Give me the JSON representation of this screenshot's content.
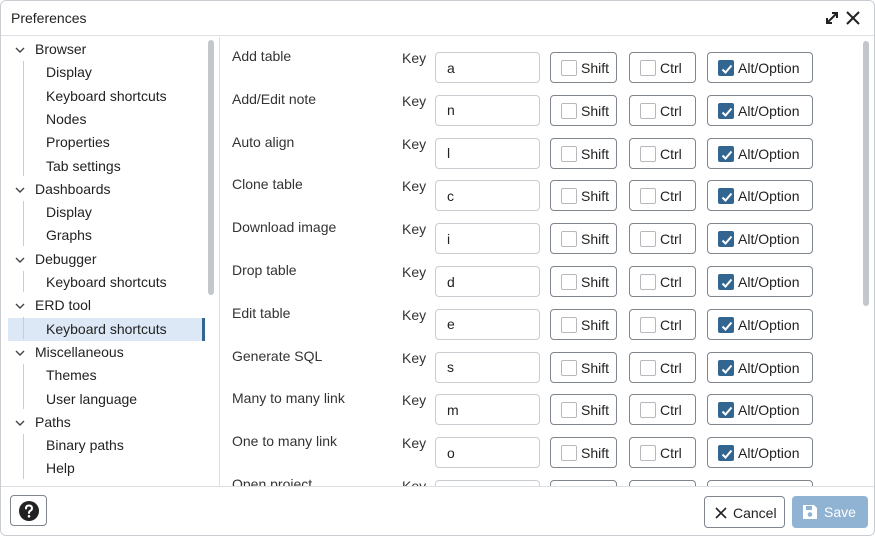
{
  "window": {
    "title": "Preferences"
  },
  "sidebar": {
    "groups": [
      {
        "label": "Browser",
        "children": [
          "Display",
          "Keyboard shortcuts",
          "Nodes",
          "Properties",
          "Tab settings"
        ]
      },
      {
        "label": "Dashboards",
        "children": [
          "Display",
          "Graphs"
        ]
      },
      {
        "label": "Debugger",
        "children": [
          "Keyboard shortcuts"
        ]
      },
      {
        "label": "ERD tool",
        "children": [
          "Keyboard shortcuts"
        ]
      },
      {
        "label": "Miscellaneous",
        "children": [
          "Themes",
          "User language"
        ]
      },
      {
        "label": "Paths",
        "children": [
          "Binary paths",
          "Help"
        ]
      }
    ],
    "selected": "ERD tool / Keyboard shortcuts"
  },
  "shortcuts": {
    "key_label": "Key",
    "shift_label": "Shift",
    "ctrl_label": "Ctrl",
    "alt_label": "Alt/Option",
    "rows": [
      {
        "label": "Add table",
        "key": "a",
        "shift": false,
        "ctrl": false,
        "alt": true
      },
      {
        "label": "Add/Edit note",
        "key": "n",
        "shift": false,
        "ctrl": false,
        "alt": true
      },
      {
        "label": "Auto align",
        "key": "l",
        "shift": false,
        "ctrl": false,
        "alt": true
      },
      {
        "label": "Clone table",
        "key": "c",
        "shift": false,
        "ctrl": false,
        "alt": true
      },
      {
        "label": "Download image",
        "key": "i",
        "shift": false,
        "ctrl": false,
        "alt": true
      },
      {
        "label": "Drop table",
        "key": "d",
        "shift": false,
        "ctrl": false,
        "alt": true
      },
      {
        "label": "Edit table",
        "key": "e",
        "shift": false,
        "ctrl": false,
        "alt": true
      },
      {
        "label": "Generate SQL",
        "key": "s",
        "shift": false,
        "ctrl": false,
        "alt": true
      },
      {
        "label": "Many to many link",
        "key": "m",
        "shift": false,
        "ctrl": false,
        "alt": true
      },
      {
        "label": "One to many link",
        "key": "o",
        "shift": false,
        "ctrl": false,
        "alt": true
      },
      {
        "label": "Open project",
        "key": "",
        "shift": false,
        "ctrl": false,
        "alt": true
      }
    ]
  },
  "footer": {
    "cancel_label": "Cancel",
    "save_label": "Save"
  },
  "colors": {
    "accent": "#326690",
    "selected_bg": "#dde8f7",
    "save_disabled": "#90b3d3"
  },
  "icons": {
    "expand": "expand-diagonal-icon",
    "close": "close-icon",
    "help": "help-circle-icon",
    "cancel": "close-icon",
    "save": "floppy-disk-icon",
    "tree": "chevron-down-icon",
    "checkbox": "checkmark-icon"
  }
}
